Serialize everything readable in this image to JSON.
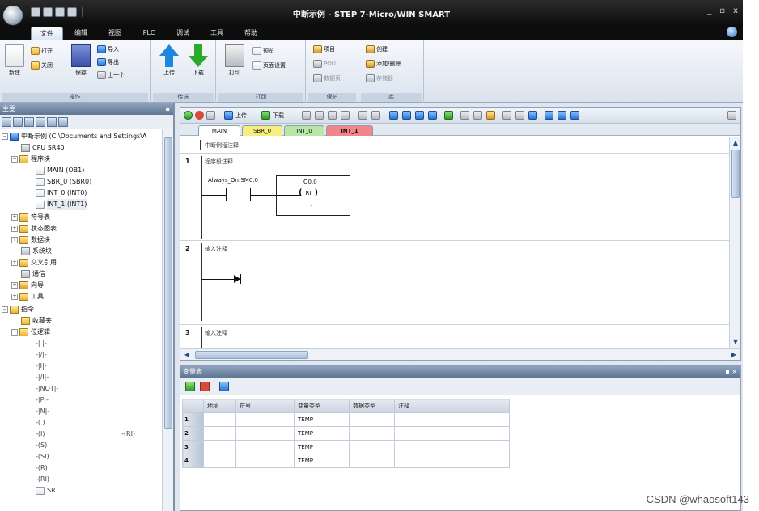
{
  "window": {
    "title": "中断示例 - STEP 7-Micro/WIN SMART",
    "controls": [
      "_",
      "▫",
      "x"
    ]
  },
  "ribbon": {
    "tabs": [
      "文件",
      "编辑",
      "视图",
      "PLC",
      "调试",
      "工具",
      "帮助"
    ],
    "active_tab": "文件",
    "groups": [
      {
        "label": "操作"
      },
      {
        "label": "传送"
      },
      {
        "label": "打印"
      },
      {
        "label": "保护"
      },
      {
        "label": "库"
      }
    ],
    "buttons": {
      "new": "新建",
      "open": "打开",
      "close": "关闭",
      "save": "保存",
      "import": "导入",
      "export": "导出",
      "previous": "上一个",
      "upload": "上传",
      "download": "下载",
      "print": "打印",
      "preview": "预览",
      "page_setup": "页面设置",
      "project": "项目",
      "pou": "POU",
      "data_page": "数据页",
      "library": "创建",
      "add_remove": "添加/删除",
      "memory": "存储器"
    }
  },
  "project_tree": {
    "header": "主要",
    "root": "中断示例 (C:\\Documents and Settings\\A",
    "cpu": "CPU SR40",
    "program_block": "程序块",
    "pous": [
      "MAIN (OB1)",
      "SBR_0 (SBR0)",
      "INT_0 (INT0)",
      "INT_1 (INT1)"
    ],
    "folders": [
      "符号表",
      "状态图表",
      "数据块",
      "系统块",
      "交叉引用",
      "通信",
      "向导",
      "工具"
    ],
    "instructions": "指令",
    "favorites": "收藏夹",
    "bit_logic": "位逻辑",
    "bit_items": [
      "-| |-",
      "-|/|-",
      "-|I|-",
      "-|/I|-",
      "-|NOT|-",
      "-|P|-",
      "-|N|-",
      "-( )",
      "-(I)",
      "-(S)",
      "-(SI)",
      "-(R)",
      "-(RI)",
      "SR"
    ],
    "floating_hint": "-(RI)"
  },
  "editor": {
    "toolbar": {
      "upload": "上传",
      "download": "下载"
    },
    "tabs": [
      {
        "label": "MAIN",
        "color": "#ffffff"
      },
      {
        "label": "SBR_0",
        "color": "#f7ee80"
      },
      {
        "label": "INT_0",
        "color": "#b7e8a8"
      },
      {
        "label": "INT_1",
        "color": "#f2858a"
      }
    ],
    "program_comment": "中断例程注释",
    "networks": [
      {
        "number": "1",
        "comment": "程序段注释",
        "contact": "Always_On:SM0.0",
        "coil_addr": "Q0.0",
        "coil": "RI",
        "coil_count": "1"
      },
      {
        "number": "2",
        "comment": "输入注释"
      },
      {
        "number": "3",
        "comment": "输入注释"
      }
    ]
  },
  "variable_table": {
    "header": "变量表",
    "columns": [
      "地址",
      "符号",
      "变量类型",
      "数据类型",
      "注释"
    ],
    "rows": [
      {
        "num": "1",
        "addr": "",
        "symbol": "",
        "var_type": "TEMP",
        "data_type": "",
        "comment": ""
      },
      {
        "num": "2",
        "addr": "",
        "symbol": "",
        "var_type": "TEMP",
        "data_type": "",
        "comment": ""
      },
      {
        "num": "3",
        "addr": "",
        "symbol": "",
        "var_type": "TEMP",
        "data_type": "",
        "comment": ""
      },
      {
        "num": "4",
        "addr": "",
        "symbol": "",
        "var_type": "TEMP",
        "data_type": "",
        "comment": ""
      }
    ]
  },
  "watermark": "CSDN @whaosoft143",
  "colors": {
    "accent": "#1f86e0",
    "titlebar": "#111111",
    "panel_header": "#6d84a3"
  }
}
